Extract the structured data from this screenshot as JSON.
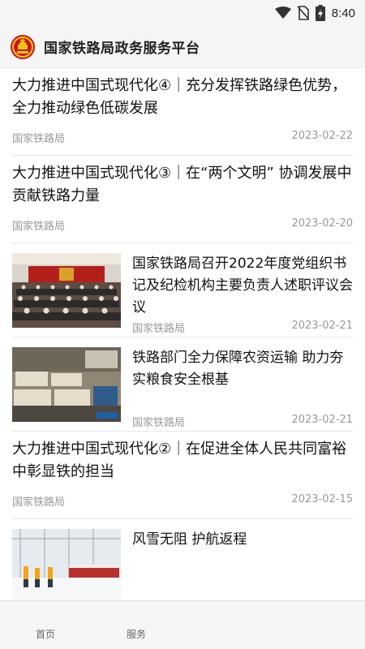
{
  "status_bar": {
    "time": "8:40"
  },
  "header": {
    "title": "国家铁路局政务服务平台"
  },
  "news": [
    {
      "headline": "大力推进中国式现代化④｜充分发挥铁路绿色优势，全力推动绿色低碳发展",
      "source": "国家铁路局",
      "date": "2023-02-22"
    },
    {
      "headline": "大力推进中国式现代化③｜在“两个文明” 协调发展中贡献铁路力量",
      "source": "国家铁路局",
      "date": "2023-02-20"
    },
    {
      "headline": "国家铁路局召开2022年度党组织书记及纪检机构主要负责人述职评议会议",
      "source": "国家铁路局",
      "date": "2023-02-21",
      "thumbnail": "meeting-hall-photo"
    },
    {
      "headline": "铁路部门全力保障农资运输 助力夯实粮食安全根基",
      "source": "国家铁路局",
      "date": "2023-02-21",
      "thumbnail": "warehouse-cargo-photo"
    },
    {
      "headline": "大力推进中国式现代化②｜在促进全体人民共同富裕中彰显铁的担当",
      "source": "国家铁路局",
      "date": "2023-02-15"
    },
    {
      "headline": "风雪无阻 护航返程",
      "thumbnail": "snowy-railway-photo"
    }
  ],
  "bottom_nav": {
    "tabs": [
      "首页",
      "服务"
    ]
  }
}
